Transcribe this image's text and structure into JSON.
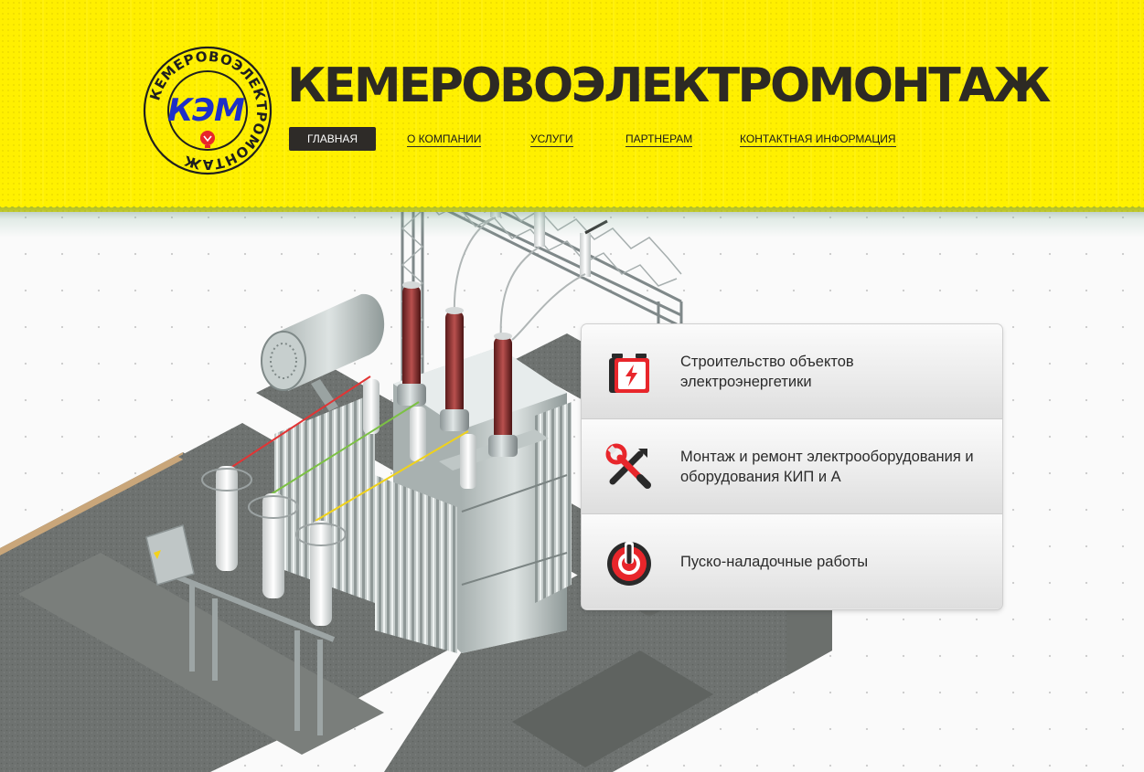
{
  "brand": {
    "title": "КЕМЕРОВОЭЛЕКТРОМОНТАЖ",
    "logo_ring_text": "КЕМЕРОВОЭЛЕКТРОМОНТАЖ",
    "logo_abbr": "КЭМ",
    "colors": {
      "yellow": "#fff100",
      "dark": "#2d2a24",
      "logo_blue": "#1e2fc8",
      "accent_red": "#e8262b"
    }
  },
  "nav": {
    "items": [
      {
        "label": "ГЛАВНАЯ",
        "active": true
      },
      {
        "label": "О КОМПАНИИ",
        "active": false
      },
      {
        "label": "УСЛУГИ",
        "active": false
      },
      {
        "label": "ПАРТНЕРАМ",
        "active": false
      },
      {
        "label": "КОНТАКТНАЯ ИНФОРМАЦИЯ",
        "active": false
      }
    ]
  },
  "services": [
    {
      "icon": "battery-charge-icon",
      "label": "Строительство объектов электроэнергетики"
    },
    {
      "icon": "tools-icon",
      "label": "Монтаж и ремонт электрооборудования и оборудования КИП и А"
    },
    {
      "icon": "power-button-icon",
      "label": "Пуско-наладочные работы"
    }
  ],
  "hero": {
    "illustration": "power-transformer-substation"
  }
}
